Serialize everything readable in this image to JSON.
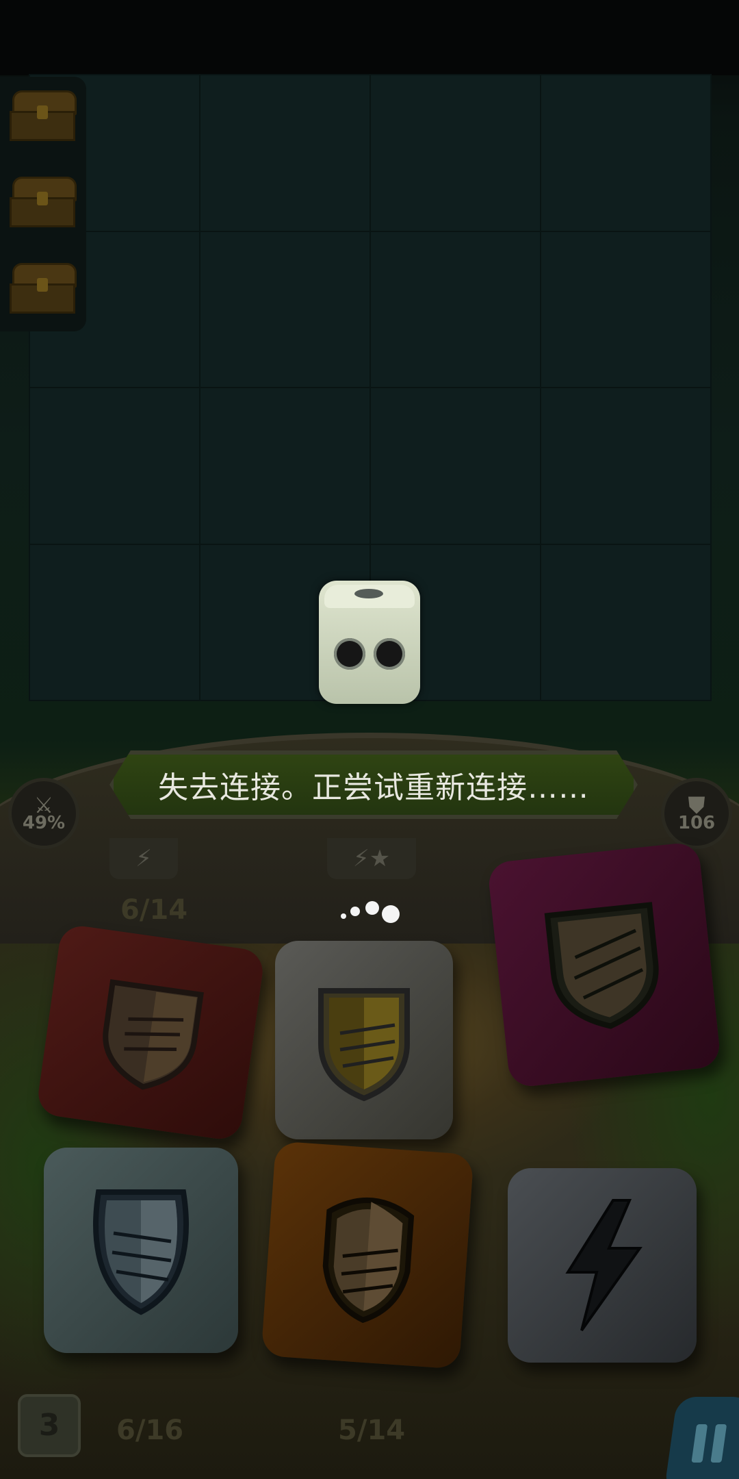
{
  "status": {
    "message": "失去连接。正尝试重新连接……"
  },
  "stats": {
    "attack_percent": "49%",
    "defense_value": "106"
  },
  "counters": {
    "top_left": "6/14",
    "bottom_left": "6/16",
    "bottom_middle": "5/14"
  },
  "footer": {
    "turn_number": "3"
  },
  "icons": {
    "attack": "crossed-swords-icon",
    "defense": "shield-icon",
    "energy": "lightning-icon",
    "star": "star-icon",
    "pause": "pause-icon",
    "chest": "treasure-chest-icon"
  },
  "colors": {
    "banner": "#2f4412",
    "die_red": "#4a1614",
    "die_grey": "#4b4b48",
    "die_purple": "#3a0d22",
    "die_teal": "#3b4a4a",
    "die_orange": "#4a2808",
    "die_dark": "#3a3e42"
  }
}
